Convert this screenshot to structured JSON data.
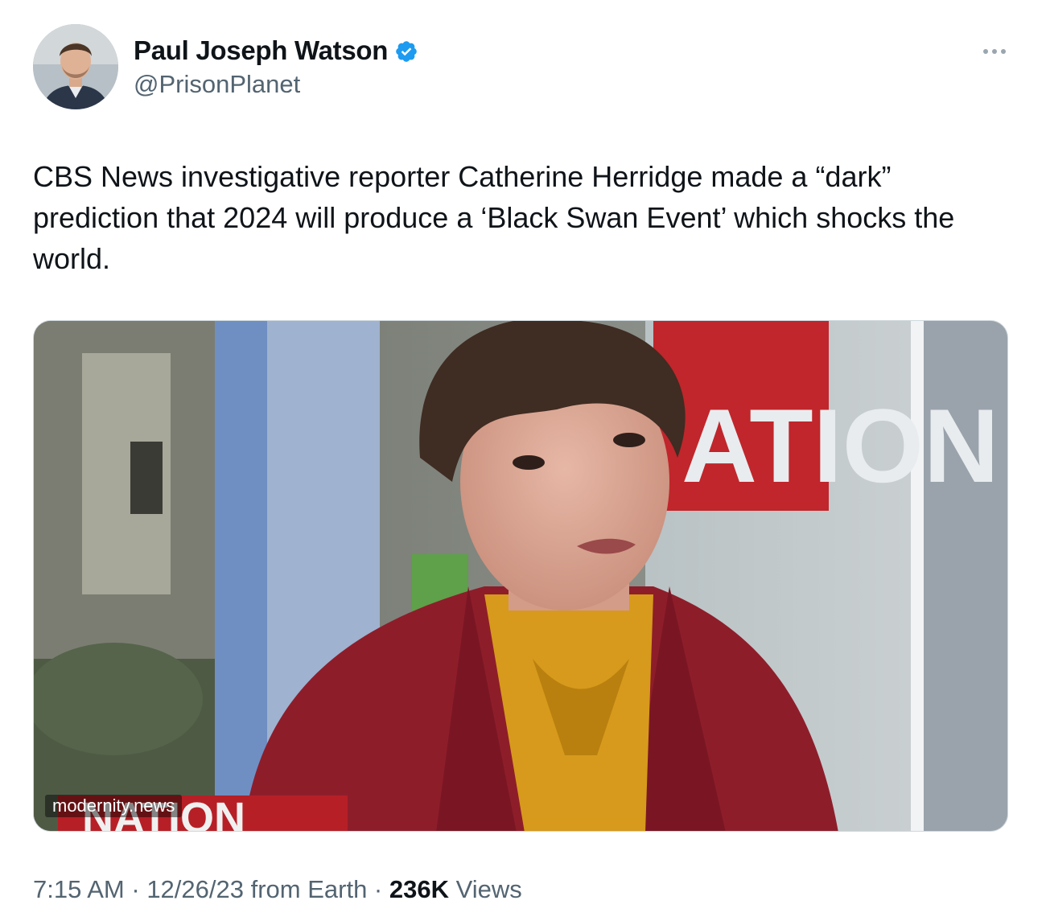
{
  "author": {
    "display_name": "Paul Joseph Watson",
    "handle": "@PrisonPlanet",
    "verified": true,
    "avatar_icon": "profile-photo",
    "verified_icon": "verified-badge-icon"
  },
  "menu": {
    "icon": "more-horizontal-icon"
  },
  "tweet": {
    "text": "CBS News investigative reporter Catherine Herridge made a “dark” prediction that 2024 will produce a ‘Black Swan Event’ which shocks the world."
  },
  "media": {
    "type": "video-still",
    "watermark": "modernity.news",
    "backdrop_text_top": "ATION",
    "backdrop_text_bottom": "NATION"
  },
  "meta": {
    "time": "7:15 AM",
    "separator_1": " · ",
    "date": "12/26/23",
    "source": " from Earth",
    "separator_2": " · ",
    "views_count": "236K",
    "views_label": " Views"
  },
  "colors": {
    "text_primary": "#0f1419",
    "text_secondary": "#536471",
    "verified_blue": "#1d9bf0",
    "jacket_red": "#8e1d2a",
    "blouse_mustard": "#d79a1c"
  }
}
